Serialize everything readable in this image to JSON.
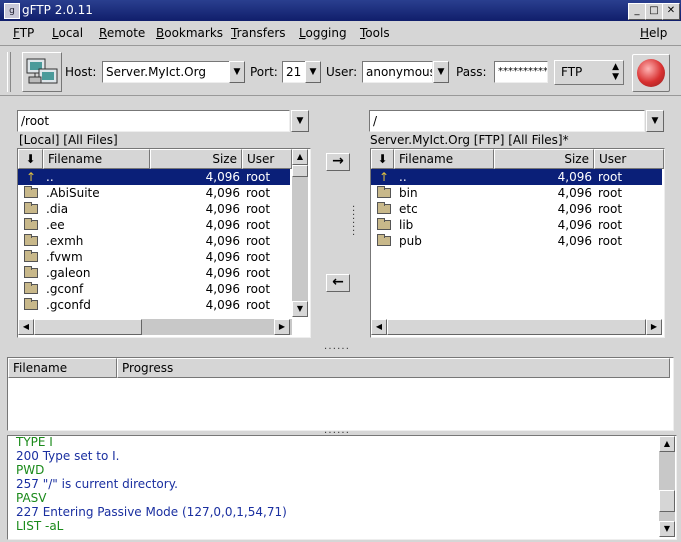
{
  "window": {
    "title": "gFTP 2.0.11",
    "buttons": [
      "_",
      "□",
      "✕"
    ]
  },
  "menubar": [
    "FTP",
    "Local",
    "Remote",
    "Bookmarks",
    "Transfers",
    "Logging",
    "Tools",
    "Help"
  ],
  "toolbar": {
    "host_label": "Host:",
    "host_value": "Server.MyIct.Org",
    "port_label": "Port:",
    "port_value": "21",
    "user_label": "User:",
    "user_value": "anonymous",
    "pass_label": "Pass:",
    "pass_value": "**********",
    "protocol": "FTP"
  },
  "local": {
    "path": "/root",
    "status": "[Local] [All Files]",
    "columns": {
      "filename": "Filename",
      "size": "Size",
      "user": "User"
    },
    "rows": [
      {
        "name": "..",
        "size": "4,096",
        "user": "root",
        "type": "up"
      },
      {
        "name": ".AbiSuite",
        "size": "4,096",
        "user": "root",
        "type": "folder"
      },
      {
        "name": ".dia",
        "size": "4,096",
        "user": "root",
        "type": "folder"
      },
      {
        "name": ".ee",
        "size": "4,096",
        "user": "root",
        "type": "folder"
      },
      {
        "name": ".exmh",
        "size": "4,096",
        "user": "root",
        "type": "folder"
      },
      {
        "name": ".fvwm",
        "size": "4,096",
        "user": "root",
        "type": "folder"
      },
      {
        "name": ".galeon",
        "size": "4,096",
        "user": "root",
        "type": "folder"
      },
      {
        "name": ".gconf",
        "size": "4,096",
        "user": "root",
        "type": "folder"
      },
      {
        "name": ".gconfd",
        "size": "4,096",
        "user": "root",
        "type": "folder"
      }
    ]
  },
  "remote": {
    "path": "/",
    "status": "Server.MyIct.Org [FTP] [All Files]*",
    "columns": {
      "filename": "Filename",
      "size": "Size",
      "user": "User"
    },
    "rows": [
      {
        "name": "..",
        "size": "4,096",
        "user": "root",
        "type": "up"
      },
      {
        "name": "bin",
        "size": "4,096",
        "user": "root",
        "type": "folder"
      },
      {
        "name": "etc",
        "size": "4,096",
        "user": "root",
        "type": "folder"
      },
      {
        "name": "lib",
        "size": "4,096",
        "user": "root",
        "type": "folder"
      },
      {
        "name": "pub",
        "size": "4,096",
        "user": "root",
        "type": "folder"
      }
    ]
  },
  "transfers": {
    "filename_header": "Filename",
    "progress_header": "Progress"
  },
  "log": [
    {
      "text": "TYPE I",
      "color": "#1a8a1a"
    },
    {
      "text": "200 Type set to I.",
      "color": "#1a2fa0"
    },
    {
      "text": "PWD",
      "color": "#1a8a1a"
    },
    {
      "text": "257 \"/\" is current directory.",
      "color": "#1a2fa0"
    },
    {
      "text": "PASV",
      "color": "#1a8a1a"
    },
    {
      "text": "227 Entering Passive Mode (127,0,0,1,54,71)",
      "color": "#1a2fa0"
    },
    {
      "text": "LIST -aL",
      "color": "#1a8a1a"
    }
  ]
}
